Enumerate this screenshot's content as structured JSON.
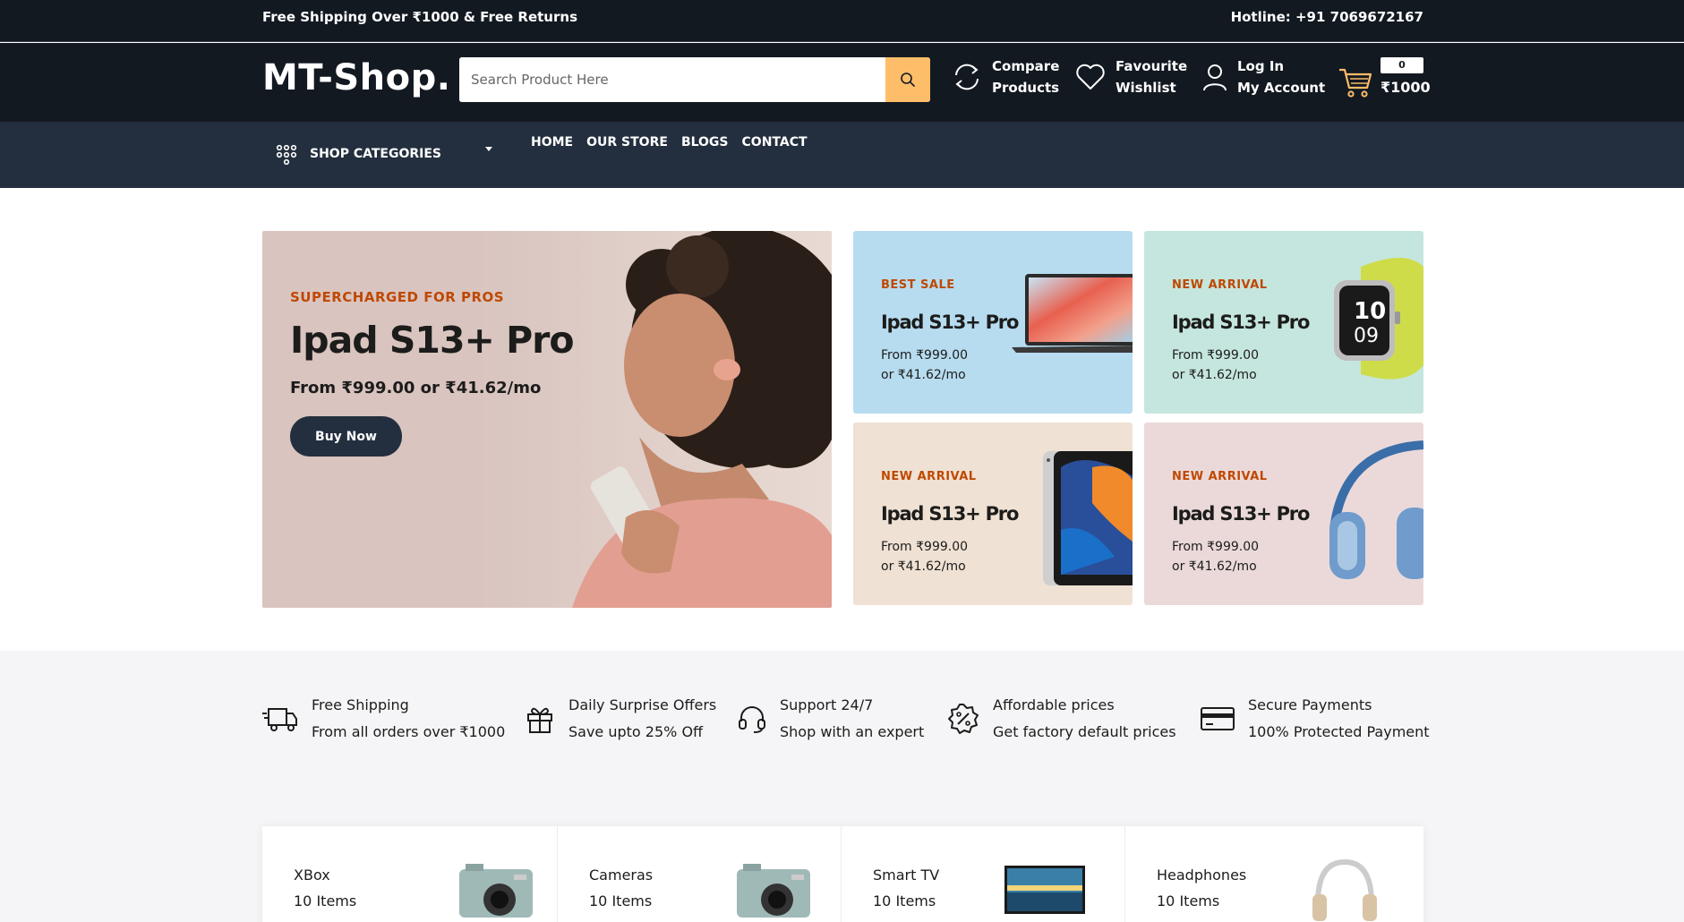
{
  "top_strip": {
    "left_text": "Free Shipping Over ₹1000 & Free Returns",
    "right_text": "Hotline: +91 7069672167"
  },
  "header": {
    "logo": "MT-Shop.",
    "search_placeholder": "Search Product Here",
    "compare_line1": "Compare",
    "compare_line2": "Products",
    "wishlist_line1": "Favourite",
    "wishlist_line2": "Wishlist",
    "account_line1": "Log In",
    "account_line2": "My Account",
    "cart_count": "0",
    "cart_total": "₹1000"
  },
  "nav": {
    "categories_label": "SHOP CATEGORIES",
    "links": [
      "HOME",
      "OUR STORE",
      "BLOGS",
      "CONTACT"
    ]
  },
  "hero": {
    "main": {
      "kicker": "SUPERCHARGED FOR PROS",
      "title": "Ipad S13+ Pro",
      "price": "From ₹999.00 or ₹41.62/mo",
      "button": "Buy Now"
    },
    "tiles": [
      {
        "kicker": "BEST SALE",
        "title": "Ipad S13+ Pro",
        "line1": "From ₹999.00",
        "line2": "or ₹41.62/mo"
      },
      {
        "kicker": "NEW ARRIVAL",
        "title": "Ipad S13+ Pro",
        "line1": "From ₹999.00",
        "line2": "or ₹41.62/mo"
      },
      {
        "kicker": "NEW ARRIVAL",
        "title": "Ipad S13+ Pro",
        "line1": "From ₹999.00",
        "line2": "or ₹41.62/mo"
      },
      {
        "kicker": "NEW ARRIVAL",
        "title": "Ipad S13+ Pro",
        "line1": "From ₹999.00",
        "line2": "or ₹41.62/mo"
      }
    ]
  },
  "services": [
    {
      "icon": "truck-icon",
      "title": "Free Shipping",
      "subtitle": "From all orders over ₹1000"
    },
    {
      "icon": "gift-icon",
      "title": "Daily Surprise Offers",
      "subtitle": "Save upto 25% Off"
    },
    {
      "icon": "headphone-icon",
      "title": "Support 24/7",
      "subtitle": "Shop with an expert"
    },
    {
      "icon": "discount-badge-icon",
      "title": "Affordable prices",
      "subtitle": "Get factory default prices"
    },
    {
      "icon": "credit-card-icon",
      "title": "Secure Payments",
      "subtitle": "100% Protected Payment"
    }
  ],
  "categories": [
    {
      "name": "XBox",
      "count": "10 Items",
      "icon": "camera-icon"
    },
    {
      "name": "Cameras",
      "count": "10 Items",
      "icon": "camera-icon"
    },
    {
      "name": "Smart TV",
      "count": "10 Items",
      "icon": "tv-icon"
    },
    {
      "name": "Headphones",
      "count": "10 Items",
      "icon": "headphones-icon"
    }
  ],
  "colors": {
    "dark": "#131921",
    "nav": "#232f3e",
    "accent": "#febd69",
    "kicker": "#bf4800"
  }
}
